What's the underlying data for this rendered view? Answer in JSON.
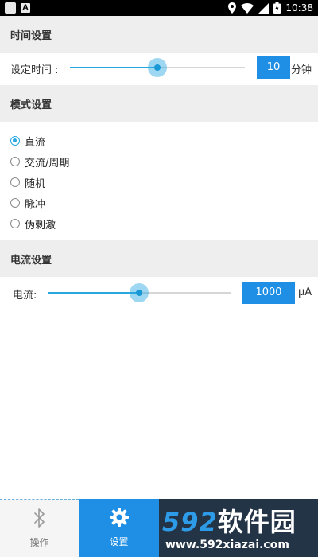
{
  "status_bar": {
    "time": "10:38",
    "app_badge": "A"
  },
  "time_settings": {
    "header": "时间设置",
    "label": "设定时间 :",
    "value": "10",
    "unit": "分钟",
    "slider_level": 0.5
  },
  "mode_settings": {
    "header": "模式设置",
    "options": [
      {
        "label": "直流",
        "selected": true
      },
      {
        "label": "交流/周期",
        "selected": false
      },
      {
        "label": "随机",
        "selected": false
      },
      {
        "label": "脉冲",
        "selected": false
      },
      {
        "label": "伪刺激",
        "selected": false
      }
    ]
  },
  "current_settings": {
    "header": "电流设置",
    "label": "电流:",
    "value": "1000",
    "unit": "μA",
    "slider_level": 0.5
  },
  "bottom_nav": {
    "tabs": [
      {
        "label": "操作",
        "icon": "bluetooth-icon",
        "active": false
      },
      {
        "label": "设置",
        "icon": "gear-icon",
        "active": true
      }
    ]
  },
  "watermark": {
    "logo_digits": "592",
    "logo_text": "软件园",
    "url": "www.592xiazai.com"
  },
  "colors": {
    "accent": "#1e8fe4",
    "slider": "#29a7e1",
    "section_bg": "#eeeeee"
  }
}
